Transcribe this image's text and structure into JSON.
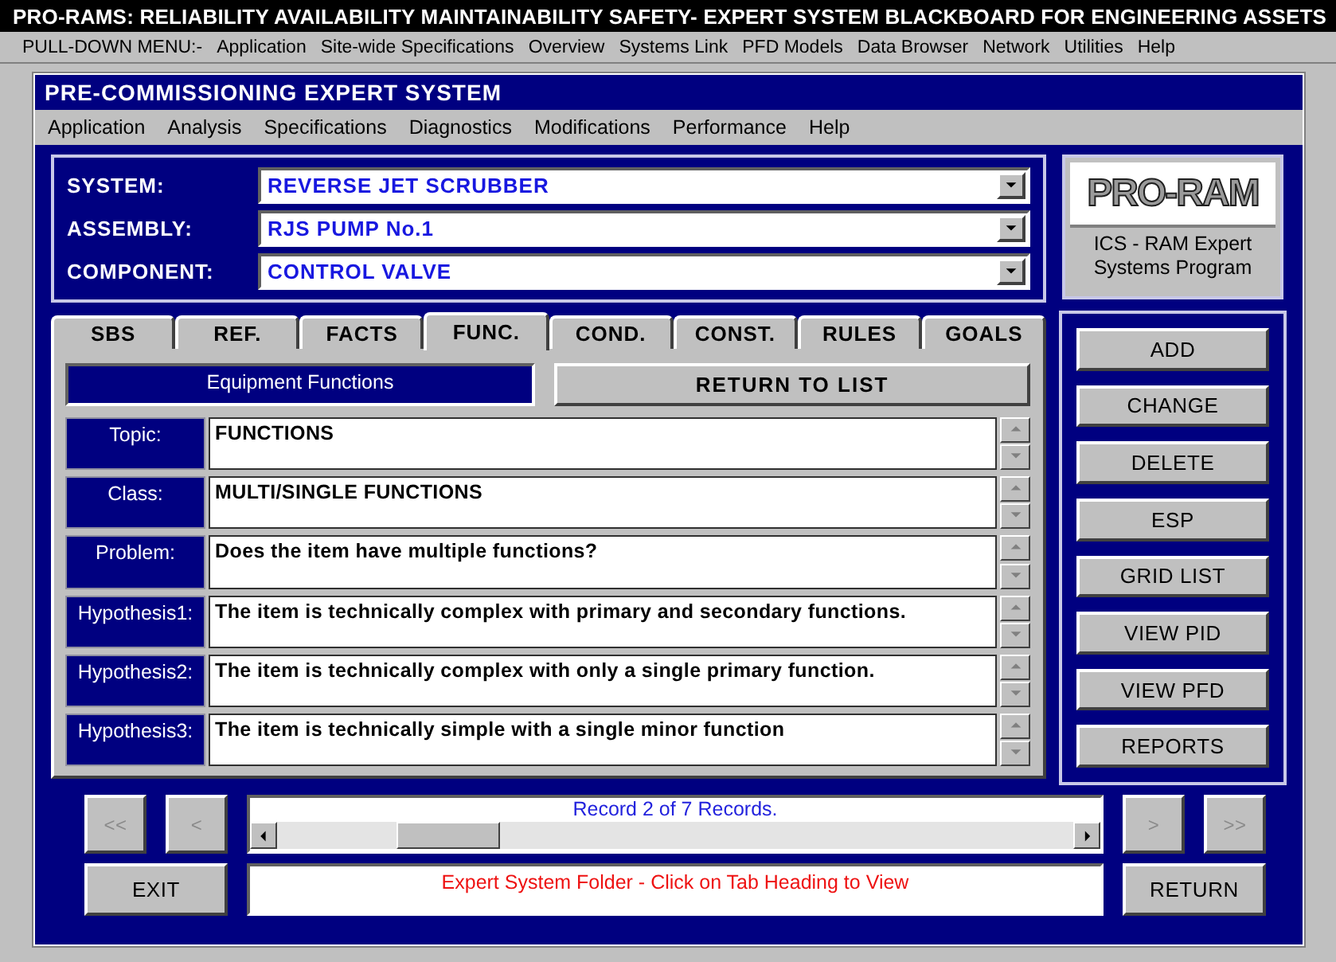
{
  "app_title": "PRO-RAMS: RELIABILITY AVAILABILITY MAINTAINABILITY SAFETY- EXPERT SYSTEM BLACKBOARD FOR ENGINEERING ASSETS",
  "main_menu": {
    "label": "PULL-DOWN MENU:-",
    "items": [
      "Application",
      "Site-wide Specifications",
      "Overview",
      "Systems Link",
      "PFD Models",
      "Data Browser",
      "Network",
      "Utilities",
      "Help"
    ]
  },
  "window": {
    "title": "PRE-COMMISSIONING EXPERT SYSTEM",
    "menu": [
      "Application",
      "Analysis",
      "Specifications",
      "Diagnostics",
      "Modifications",
      "Performance",
      "Help"
    ]
  },
  "selectors": [
    {
      "label": "SYSTEM:",
      "value": "REVERSE JET SCRUBBER"
    },
    {
      "label": "ASSEMBLY:",
      "value": "RJS PUMP No.1"
    },
    {
      "label": "COMPONENT:",
      "value": "CONTROL VALVE"
    }
  ],
  "tabs": [
    {
      "label": "SBS",
      "selected": false
    },
    {
      "label": "REF.",
      "selected": false
    },
    {
      "label": "FACTS",
      "selected": false
    },
    {
      "label": "FUNC.",
      "selected": true
    },
    {
      "label": "COND.",
      "selected": false
    },
    {
      "label": "CONST.",
      "selected": false
    },
    {
      "label": "RULES",
      "selected": false
    },
    {
      "label": "GOALS",
      "selected": false
    }
  ],
  "panel": {
    "heading": "Equipment Functions",
    "return_button": "RETURN TO LIST",
    "fields": [
      {
        "label": "Topic:",
        "value": "FUNCTIONS"
      },
      {
        "label": "Class:",
        "value": "MULTI/SINGLE FUNCTIONS"
      },
      {
        "label": "Problem:",
        "value": "Does the item have multiple functions?"
      },
      {
        "label": "Hypothesis1:",
        "value": "The item is technically complex with primary and secondary functions."
      },
      {
        "label": "Hypothesis2:",
        "value": "The item is technically complex with only a single primary function."
      },
      {
        "label": "Hypothesis3:",
        "value": "The item is technically simple with a single minor function"
      }
    ]
  },
  "logo": {
    "text": "PRO-RAM",
    "caption": "ICS - RAM Expert Systems Program"
  },
  "actions": [
    "ADD",
    "CHANGE",
    "DELETE",
    "ESP",
    "GRID LIST",
    "VIEW PID",
    "VIEW PFD",
    "REPORTS"
  ],
  "navigation": {
    "back": [
      {
        "label": "<<",
        "disabled": true
      },
      {
        "label": "<",
        "disabled": true
      }
    ],
    "forward": [
      {
        "label": ">",
        "disabled": true
      },
      {
        "label": ">>",
        "disabled": true
      }
    ],
    "record": "Record 2 of 7 Records."
  },
  "exit_button": "EXIT",
  "status_message": "Expert System Folder - Click on Tab Heading to View",
  "return_button": "RETURN"
}
